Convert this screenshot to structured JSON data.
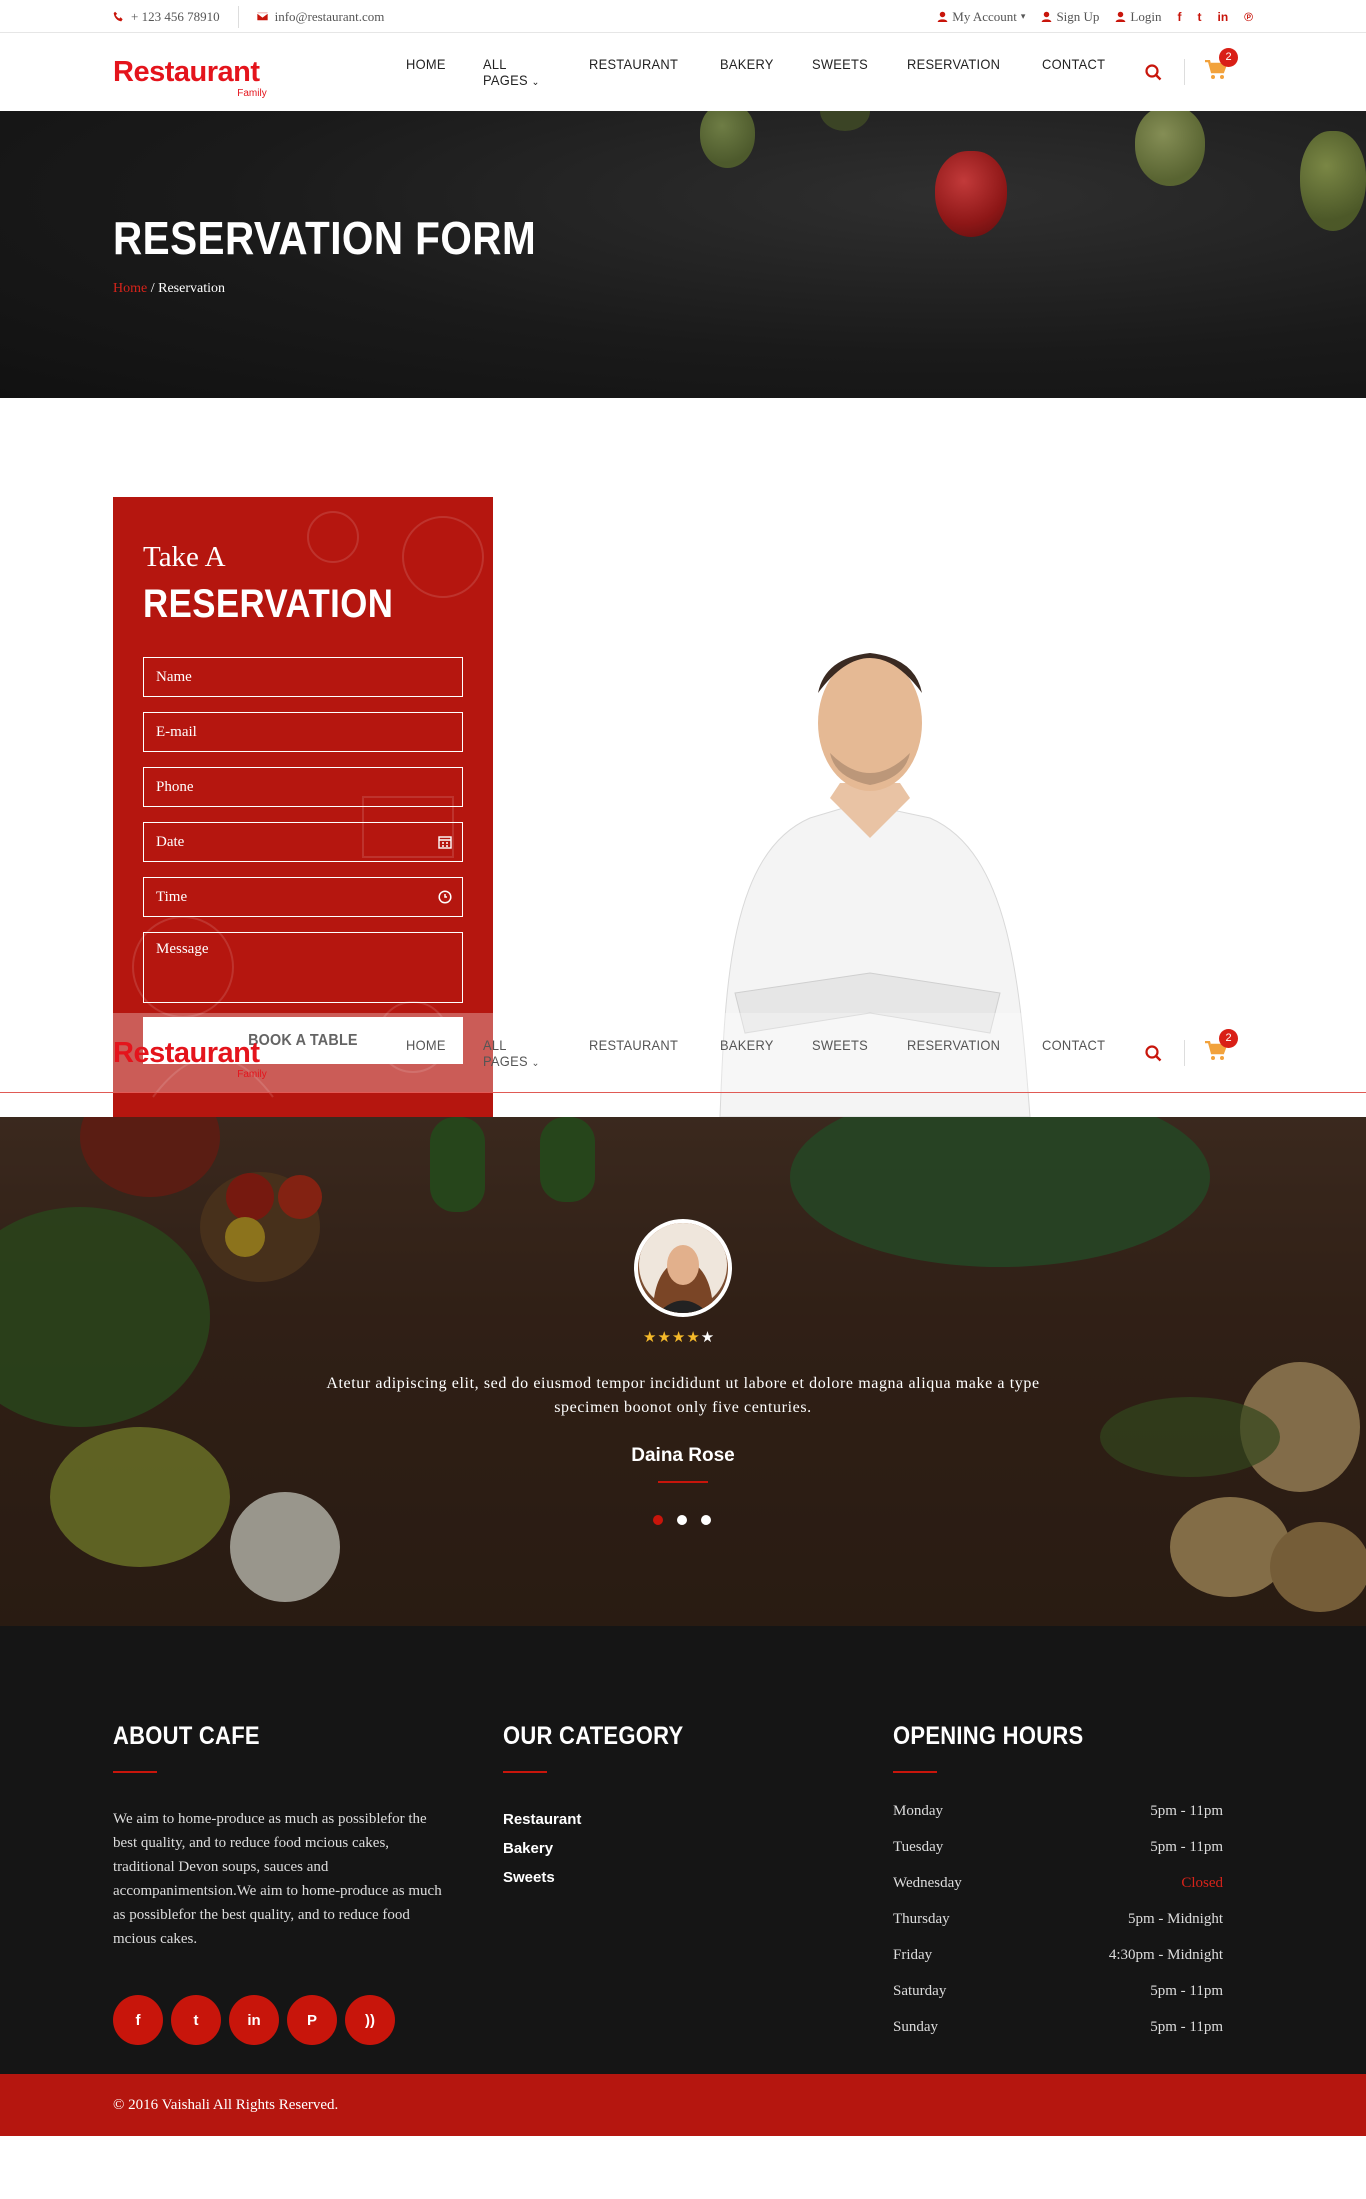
{
  "topbar": {
    "phone": "+ 123 456 78910",
    "email": "info@restaurant.com",
    "my_account": "My Account",
    "sign_up": "Sign Up",
    "login": "Login"
  },
  "header": {
    "logo": "Restaurant",
    "logo_sub": "Family",
    "nav": [
      "HOME",
      "ALL PAGES",
      "RESTAURANT",
      "BAKERY",
      "SWEETS",
      "RESERVATION",
      "CONTACT"
    ],
    "cart_count": "2"
  },
  "banner": {
    "title": "RESERVATION FORM",
    "crumb_home": "Home",
    "crumb_current": "/ Reservation"
  },
  "reservation": {
    "title_small": "Take A",
    "title_big": "RESERVATION",
    "fields": {
      "name": "Name",
      "email": "E-mail",
      "phone": "Phone",
      "date": "Date",
      "time": "Time",
      "message": "Message"
    },
    "button": "BOOK A TABLE"
  },
  "testimonial": {
    "stars_filled": "★★★★",
    "stars_empty": "★",
    "quote": "Atetur adipiscing elit, sed do eiusmod tempor incididunt ut labore et dolore magna aliqua make a type specimen boonot only five centuries.",
    "name": "Daina Rose"
  },
  "footer": {
    "about_title": "ABOUT CAFE",
    "about_text": "We aim to home-produce as much as possiblefor the best quality, and to reduce food mcious cakes, traditional Devon soups, sauces and accompanimentsion.We aim to home-produce as much as possiblefor the best quality, and to reduce food mcious cakes.",
    "category_title": "OUR CATEGORY",
    "categories": [
      "Restaurant",
      "Bakery",
      "Sweets"
    ],
    "hours_title": "OPENING HOURS",
    "hours": [
      {
        "day": "Monday",
        "time": "5pm - 11pm"
      },
      {
        "day": "Tuesday",
        "time": "5pm - 11pm"
      },
      {
        "day": "Wednesday",
        "time": "Closed"
      },
      {
        "day": "Thursday",
        "time": "5pm - Midnight"
      },
      {
        "day": "Friday",
        "time": "4:30pm - Midnight"
      },
      {
        "day": "Saturday",
        "time": "5pm - 11pm"
      },
      {
        "day": "Sunday",
        "time": "5pm - 11pm"
      }
    ],
    "copyright": "© 2016 Vaishali All Rights Reserved."
  },
  "colors": {
    "brand_red": "#c8150b",
    "footer_bg": "#151515",
    "star": "#f5b92a"
  }
}
